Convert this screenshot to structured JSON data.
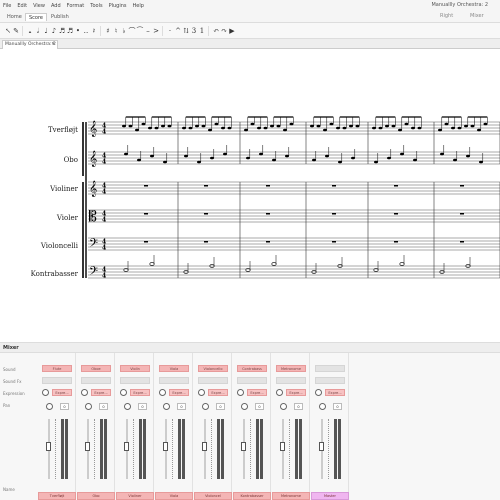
{
  "menubar": {
    "items": [
      "File",
      "Edit",
      "View",
      "Add",
      "Format",
      "Tools",
      "Plugins",
      "Help"
    ],
    "window_title": "Manuallly Orchestra: 2"
  },
  "tabs": {
    "home": "Home",
    "score": "Score",
    "publish": "Publish"
  },
  "topright": {
    "item1": "Right",
    "item2": "Mixer"
  },
  "toolbar": {
    "icons": [
      "arrow-icon",
      "note-input-icon",
      "whole-note-icon",
      "half-note-icon",
      "quarter-note-icon",
      "eighth-note-icon",
      "sixteenth-note-icon",
      "thirty-second-note-icon",
      "dot-icon",
      "double-dot-icon",
      "rest-icon",
      "sharp-icon",
      "natural-icon",
      "flat-icon",
      "tie-icon",
      "slur-icon",
      "tenuto-icon",
      "accent-icon",
      "staccato-icon",
      "marcato-icon",
      "flip-icon",
      "tuplet-icon",
      "voice-icon",
      "undo-icon",
      "redo-icon",
      "playback-icon"
    ]
  },
  "document": {
    "tab_label": "Manuallly Orchestra: 2",
    "tab_close": "✕"
  },
  "score": {
    "instruments": [
      "Tverfløjt",
      "Obo",
      "Violiner",
      "Violer",
      "Violoncelli",
      "Kontrabasser"
    ],
    "time_signature": "4/4"
  },
  "mixer": {
    "title": "Mixer",
    "row_labels": [
      "Sound",
      "Sound Fx",
      "Expression",
      "Pan"
    ],
    "channels": [
      {
        "name": "Tverfløjt",
        "sound": "Flute",
        "pan": "0",
        "volume": 0.55
      },
      {
        "name": "Obo",
        "sound": "Oboe",
        "pan": "0",
        "volume": 0.55
      },
      {
        "name": "Violiner",
        "sound": "Violin",
        "pan": "0",
        "volume": 0.55
      },
      {
        "name": "Viola",
        "sound": "Viola",
        "pan": "0",
        "volume": 0.55
      },
      {
        "name": "Violoncel",
        "sound": "Violoncello",
        "pan": "0",
        "volume": 0.55
      },
      {
        "name": "Kontrabasser",
        "sound": "Contrabass",
        "pan": "0",
        "volume": 0.55
      },
      {
        "name": "Metronome",
        "sound": "Metronome",
        "pan": "0",
        "volume": 0.55
      },
      {
        "name": "Master",
        "sound": "",
        "pan": "0",
        "volume": 0.55
      }
    ],
    "expression_label": "Expre..."
  }
}
